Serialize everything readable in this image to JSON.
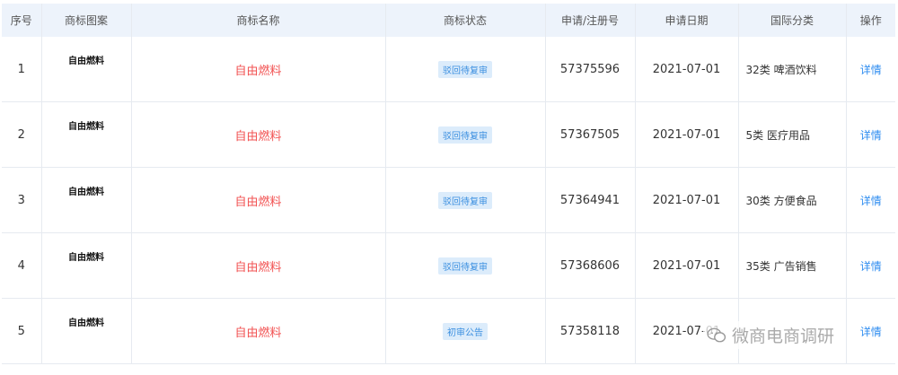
{
  "table": {
    "headers": [
      "序号",
      "商标图案",
      "商标名称",
      "商标状态",
      "申请/注册号",
      "申请日期",
      "国际分类",
      "操作"
    ],
    "rows": [
      {
        "index": "1",
        "image_text": "自由燃料",
        "name": "自由燃料",
        "status": "驳回待复审",
        "reg_no": "57375596",
        "date": "2021-07-01",
        "classification": "32类 啤酒饮料",
        "action": "详情"
      },
      {
        "index": "2",
        "image_text": "自由燃料",
        "name": "自由燃料",
        "status": "驳回待复审",
        "reg_no": "57367505",
        "date": "2021-07-01",
        "classification": "5类 医疗用品",
        "action": "详情"
      },
      {
        "index": "3",
        "image_text": "自由燃料",
        "name": "自由燃料",
        "status": "驳回待复审",
        "reg_no": "57364941",
        "date": "2021-07-01",
        "classification": "30类 方便食品",
        "action": "详情"
      },
      {
        "index": "4",
        "image_text": "自由燃料",
        "name": "自由燃料",
        "status": "驳回待复审",
        "reg_no": "57368606",
        "date": "2021-07-01",
        "classification": "35类 广告销售",
        "action": "详情"
      },
      {
        "index": "5",
        "image_text": "自由燃料",
        "name": "自由燃料",
        "status": "初审公告",
        "reg_no": "57358118",
        "date": "2021-07-01",
        "classification": "",
        "action": "详情"
      }
    ]
  },
  "watermark": {
    "text": "微商电商调研",
    "icon": "wechat-icon"
  },
  "colors": {
    "header_bg": "#edf3fb",
    "name_red": "#f25252",
    "status_bg": "#dcecfb",
    "status_text": "#3b8fe0",
    "link_blue": "#2d8cf0"
  }
}
